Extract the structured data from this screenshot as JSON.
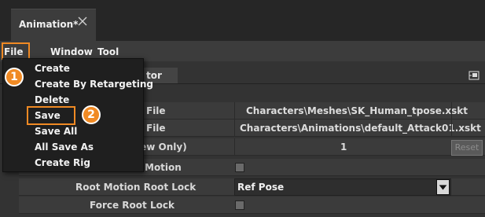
{
  "tab": {
    "title": "Animation*"
  },
  "menubar": {
    "file": "File",
    "window": "Window",
    "tool": "Tool"
  },
  "panel": {
    "tab_label": "tor"
  },
  "properties": [
    {
      "label": "File",
      "value": "Characters\\Meshes\\SK_Human_tpose.xskt"
    },
    {
      "label": "File",
      "value": "Characters\\Animations\\default_Attack01.xskt"
    },
    {
      "label": "iew Only)",
      "value": "1",
      "button": "Reset"
    },
    {
      "label": "Motion"
    },
    {
      "label": "Root Motion Root Lock",
      "value": "Ref Pose"
    },
    {
      "label": "Force Root Lock"
    }
  ],
  "file_menu": [
    "Create",
    "Create By Retargeting",
    "Delete",
    "Save",
    "Save All",
    "All Save As",
    "Create Rig"
  ],
  "badges": {
    "one": "1",
    "two": "2"
  },
  "colors": {
    "highlight": "#f08a24",
    "menu_bg": "#1f1f1f",
    "panel_bg": "#3b3b3b"
  }
}
